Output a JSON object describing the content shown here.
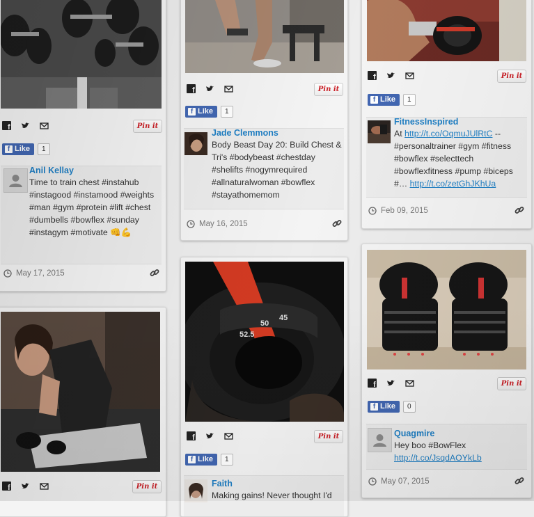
{
  "pin_label": "Pin it",
  "like_label": "Like",
  "cards": {
    "dumbbell_rack": {
      "like_count": "1",
      "author": "Anil Kellay",
      "text": "Time to train chest #instahub #instagood #instamood #weights #man #gym #protein #lift #chest #dumbells #bowflex #sunday #instagym #motivate",
      "emoji": "👊💪",
      "date": "May 17, 2015"
    },
    "woman_bench": {
      "like_count": "1",
      "author": "Jade Clemmons",
      "text": "Body Beast Day 20: Build Chest & Tri's #bodybeast #chestday #shelifts #nogymrequired #allnaturalwoman #bowflex #stayathomemom",
      "date": "May 16, 2015"
    },
    "fitness_inspired": {
      "like_count": "1",
      "author": "FitnessInspired",
      "text_prefix": "At",
      "link1": "http://t.co/OqmuJUlRtC",
      "text_mid": "-- #personaltrainer #gym #fitness #bowflex #selecttech #bowflexfitness #pump #biceps #…",
      "link2": "http://t.co/zetGhJKhUa",
      "date": "Feb 09, 2015"
    },
    "selfie": {},
    "weight_dial": {
      "like_count": "1",
      "author": "Faith",
      "text": "Making gains! Never thought I'd",
      "dial": [
        "52.5",
        "50",
        "45"
      ]
    },
    "quagmire": {
      "like_count": "0",
      "author": "Quagmire",
      "text": "Hey boo #BowFlex",
      "link": "http://t.co/JsqdAOYkLb",
      "date": "May 07, 2015"
    }
  },
  "colors": {
    "link": "#1f7fc4",
    "facebook": "#4267b2",
    "pinterest": "#cb2027"
  }
}
